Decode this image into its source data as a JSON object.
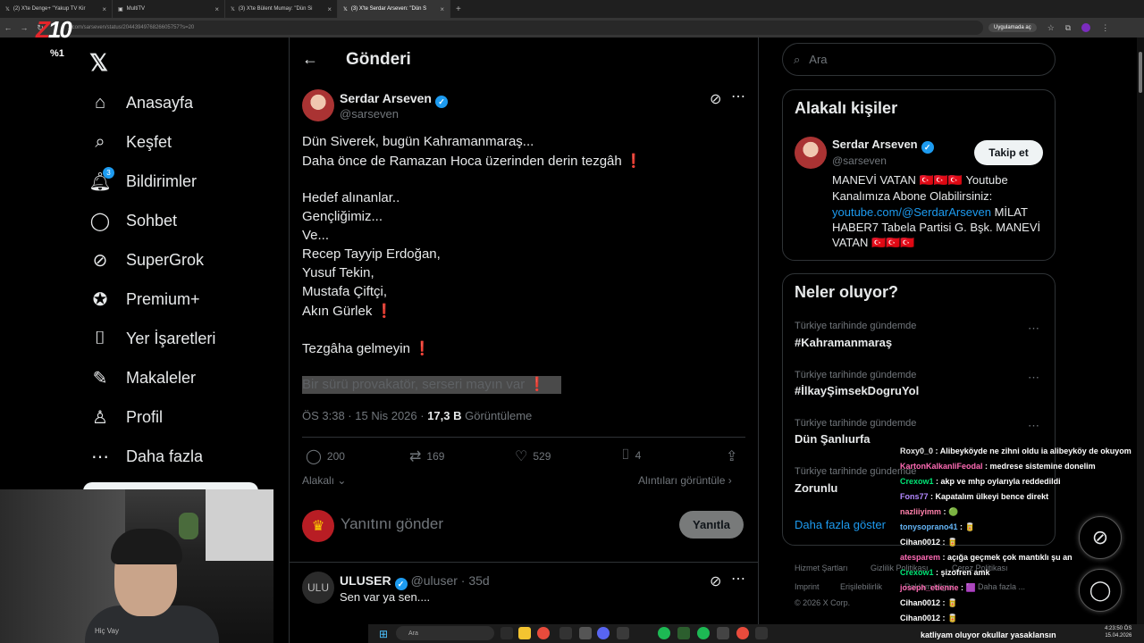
{
  "browser": {
    "tabs": [
      {
        "label": "(2) X'te Denge+ \"Yakup TV Kir",
        "active": false
      },
      {
        "label": "MultiTV",
        "active": false
      },
      {
        "label": "(3) X'te Bülent Mumay: \"Dün Si",
        "active": false
      },
      {
        "label": "(3) X'te Serdar Arseven: \"Dün S",
        "active": true
      }
    ],
    "url": "x.com/sarseven/status/2044394976826605757?s=20",
    "app_chip": "Uygulamada aç"
  },
  "stream": {
    "logo_z": "Z",
    "logo_rest": "10",
    "percent": "%1"
  },
  "sidebar": {
    "items": [
      {
        "label": "Anasayfa",
        "icon": "home-icon"
      },
      {
        "label": "Keşfet",
        "icon": "search-icon"
      },
      {
        "label": "Bildirimler",
        "icon": "bell-icon",
        "badge": "3"
      },
      {
        "label": "Sohbet",
        "icon": "chat-icon"
      },
      {
        "label": "SuperGrok",
        "icon": "grok-icon"
      },
      {
        "label": "Premium+",
        "icon": "premium-icon"
      },
      {
        "label": "Yer İşaretleri",
        "icon": "bookmark-icon"
      },
      {
        "label": "Makaleler",
        "icon": "article-icon"
      },
      {
        "label": "Profil",
        "icon": "profile-icon"
      },
      {
        "label": "Daha fazla",
        "icon": "more-circle-icon"
      }
    ]
  },
  "header": {
    "title": "Gönderi"
  },
  "post": {
    "author_name": "Serdar Arseven",
    "author_handle": "@sarseven",
    "lines": [
      "Dün Siverek, bugün Kahramanmaraş...",
      "Daha önce de Ramazan Hoca üzerinden derin tezgâh",
      "",
      "Hedef alınanlar..",
      "Gençliğimiz...",
      "Ve...",
      "Recep Tayyip Erdoğan,",
      "Yusuf Tekin,",
      "Mustafa Çiftçi,",
      "Akın Gürlek",
      "",
      "Tezgâha gelmeyin"
    ],
    "highlighted_line": "Bir sürü provakatör, serseri mayın var",
    "time": "ÖS 3:38 · 15 Nis 2026 ·",
    "views": "17,3 B",
    "views_label": "Görüntüleme",
    "replies": "200",
    "reposts": "169",
    "likes": "529",
    "bookmarks": "4",
    "relevance": "Alakalı",
    "quotes_link": "Alıntıları görüntüle"
  },
  "reply_box": {
    "placeholder": "Yanıtını gönder",
    "button": "Yanıtla"
  },
  "reply": {
    "name": "ULUSER",
    "handle": "@uluser · 35d",
    "text": "Sen var ya sen....",
    "avatar_text": "ULU"
  },
  "right": {
    "search_placeholder": "Ara",
    "related_title": "Alakalı kişiler",
    "related_name": "Serdar Arseven",
    "related_handle": "@sarseven",
    "follow_label": "Takip et",
    "bio_1": "MANEVİ VATAN 🇹🇷🇹🇷🇹🇷 Youtube",
    "bio_2": "Kanalımıza Abone Olabilirsiniz:",
    "bio_link": "youtube.com/@SerdarArseven",
    "bio_3_rest": " MİLAT",
    "bio_4": "HABER7 Tabela Partisi G. Bşk. MANEVİ",
    "bio_5": "VATAN 🇹🇷🇹🇷🇹🇷",
    "trends_title": "Neler oluyor?",
    "trends": [
      {
        "context": "Türkiye tarihinde gündemde",
        "name": "#Kahramanmaraş"
      },
      {
        "context": "Türkiye tarihinde gündemde",
        "name": "#İlkayŞimsekDogruYol"
      },
      {
        "context": "Türkiye tarihinde gündemde",
        "name": "Dün Şanlıurfa"
      },
      {
        "context": "Türkiye tarihinde gündemde",
        "name": "Zorunlu"
      }
    ],
    "show_more": "Daha fazla göster",
    "footer": [
      "Hizmet Şartları",
      "Gizlilik Politikası",
      "Çerez Politikası",
      "Imprint",
      "Erişilebilirlik",
      "Reklam bilgisi",
      "Daha fazla ...",
      "© 2026 X Corp."
    ]
  },
  "chat": {
    "lines": [
      {
        "user": "Roxy0_0",
        "text": ": Alibeyköyde ne zihni oldu ia alibeyköy de okuyom",
        "color": "#e7e7e7"
      },
      {
        "user": "KartonKalkanliFeodal",
        "text": ": medrese sistemine donelim",
        "color": "#ff6bb5"
      },
      {
        "user": "Crexow1",
        "text": ": akp ve mhp oylarıyla reddedildi",
        "color": "#00e676"
      },
      {
        "user": "Fons77",
        "text": ": Kapatalım ülkeyi bence direkt",
        "color": "#b388ff"
      },
      {
        "user": "nazliiyimm",
        "text": ": 🟢",
        "color": "#ff80ab"
      },
      {
        "user": "tonysoprano41",
        "text": ": 🥫",
        "color": "#64b5f6"
      },
      {
        "user": "Cihan0012",
        "text": ": 🥫",
        "color": "#ffffff"
      },
      {
        "user": "atesparem",
        "text": ": açığa geçmek çok mantıklı şu an",
        "color": "#ff6bb5"
      },
      {
        "user": "Crexow1",
        "text": ": şizofren amk",
        "color": "#00e676"
      },
      {
        "user": "joseph_etienne",
        "text": ": 🟪",
        "color": "#ff6bb5"
      },
      {
        "user": "Cihan0012",
        "text": ": 🥫",
        "color": "#ffffff"
      },
      {
        "user": "Cihan0012",
        "text": ": 🥫",
        "color": "#ffffff"
      }
    ],
    "ticker": "katliyam oluyor okullar yasaklansın"
  },
  "webcam": {
    "caption": "Hiç Vay"
  },
  "taskbar": {
    "search": "Ara",
    "clock_time": "4:23:50 ÖS",
    "clock_date": "15.04.2026"
  },
  "colors": {
    "accent": "#1d9bf0",
    "background": "#000000",
    "border": "#2f3336",
    "muted": "#71767b",
    "red": "#dd2e44"
  }
}
